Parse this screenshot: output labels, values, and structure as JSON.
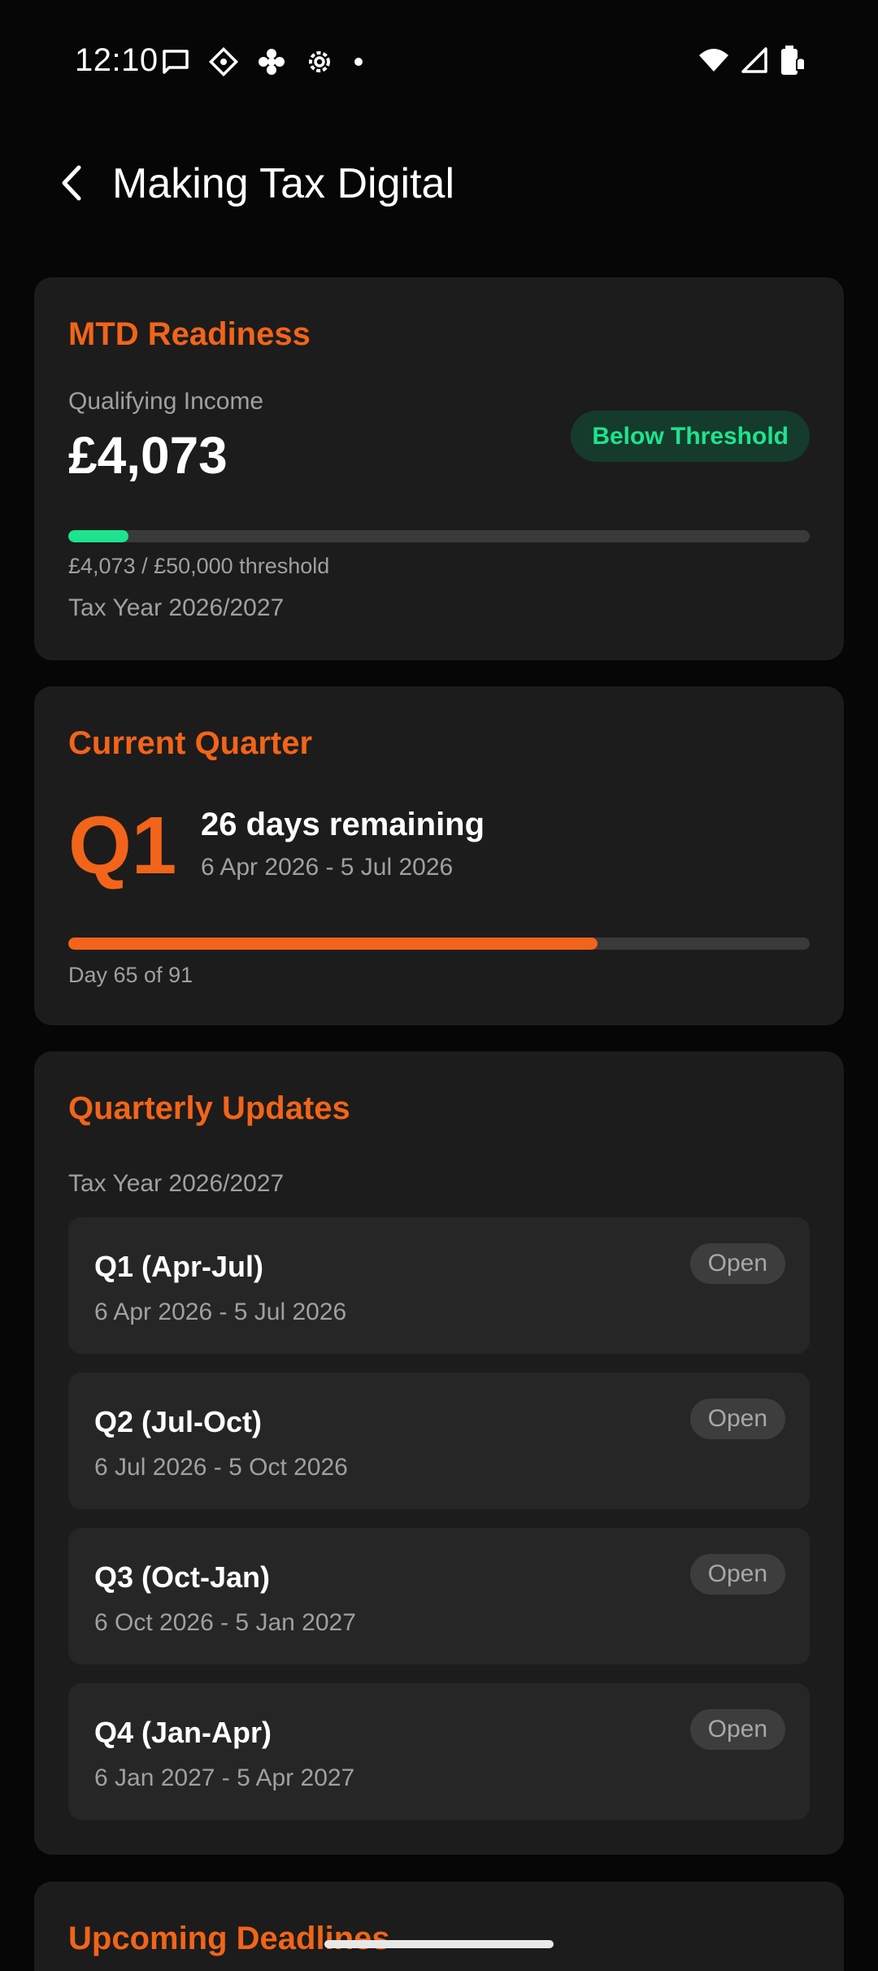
{
  "status_bar": {
    "time": "12:10",
    "left_icons": [
      "message-icon",
      "diamond-app-icon",
      "asterisk-app-icon",
      "settings-icon",
      "dot-icon"
    ],
    "right_icons": [
      "wifi-icon",
      "cellular-signal-icon",
      "battery-icon"
    ]
  },
  "app_bar": {
    "title": "Making Tax Digital",
    "back_icon": "chevron-left-icon"
  },
  "readiness": {
    "title": "MTD Readiness",
    "label": "Qualifying Income",
    "amount": "£4,073",
    "badge": "Below Threshold",
    "progress_text": "£4,073 / £50,000 threshold",
    "progress_value": 4073,
    "progress_max": 50000,
    "tax_year": "Tax Year 2026/2027"
  },
  "current_quarter": {
    "title": "Current Quarter",
    "quarter": "Q1",
    "days_remaining": "26 days remaining",
    "range": "6 Apr 2026 - 5 Jul 2026",
    "day_text": "Day 65 of 91",
    "day": 65,
    "total_days": 91
  },
  "quarterly_updates": {
    "title": "Quarterly Updates",
    "subtitle": "Tax Year 2026/2027",
    "items": [
      {
        "name": "Q1 (Apr-Jul)",
        "range": "6 Apr 2026 - 5 Jul 2026",
        "status": "Open"
      },
      {
        "name": "Q2 (Jul-Oct)",
        "range": "6 Jul 2026 - 5 Oct 2026",
        "status": "Open"
      },
      {
        "name": "Q3 (Oct-Jan)",
        "range": "6 Oct 2026 - 5 Jan 2027",
        "status": "Open"
      },
      {
        "name": "Q4 (Jan-Apr)",
        "range": "6 Jan 2027 - 5 Apr 2027",
        "status": "Open"
      }
    ]
  },
  "upcoming_deadlines": {
    "title": "Upcoming Deadlines"
  },
  "colors": {
    "accent": "#f26419",
    "success": "#1ee38e",
    "card_bg": "#1c1c1c",
    "background": "#060606"
  }
}
